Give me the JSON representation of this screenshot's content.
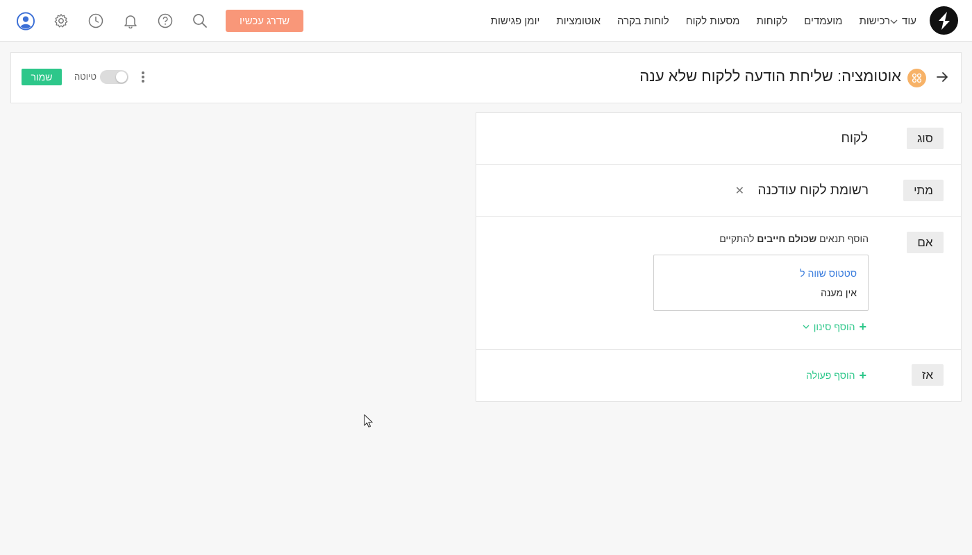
{
  "nav": {
    "items": [
      "יומן פגישות",
      "אוטומציות",
      "לוחות בקרה",
      "מסעות לקוח",
      "לקוחות",
      "מועמדים",
      "רכישות"
    ],
    "more_label": "עוד",
    "upgrade_label": "שדרג עכשיו"
  },
  "header": {
    "title": "אוטומציה: שליחת הודעה ללקוח שלא ענה",
    "draft_label": "טיוטה",
    "save_label": "שמור"
  },
  "builder": {
    "type": {
      "label": "סוג",
      "value": "לקוח"
    },
    "when": {
      "label": "מתי",
      "value": "רשומת לקוח עודכנה"
    },
    "if": {
      "label": "אם",
      "hint_prefix": "הוסף תנאים",
      "hint_bold": "שכולם חייבים",
      "hint_suffix": "להתקיים",
      "condition": {
        "field": "סטטוס שווה ל",
        "value": "אין מענה"
      },
      "add_filter_label": "הוסף סינון"
    },
    "then": {
      "label": "אז",
      "add_action_label": "הוסף פעולה"
    }
  },
  "colors": {
    "upgrade": "#f99779",
    "save": "#2dc78a",
    "link_green": "#2dc78a",
    "condition_blue": "#3b7ddd",
    "automation_icon": "#f7b267",
    "profile": "#3b6fd6"
  }
}
